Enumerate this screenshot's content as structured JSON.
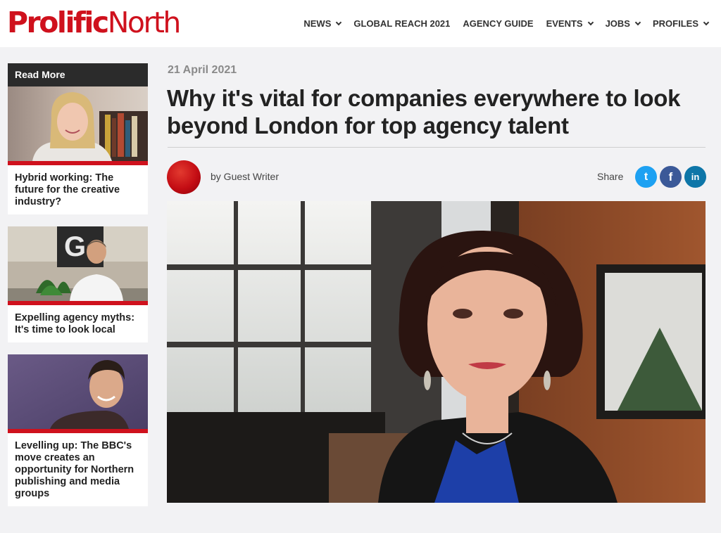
{
  "brand": {
    "part1": "Prolific",
    "part2": "North",
    "color": "#cf111d"
  },
  "nav": [
    {
      "label": "NEWS",
      "dropdown": true
    },
    {
      "label": "GLOBAL REACH 2021",
      "dropdown": false
    },
    {
      "label": "AGENCY GUIDE",
      "dropdown": false
    },
    {
      "label": "EVENTS",
      "dropdown": true
    },
    {
      "label": "JOBS",
      "dropdown": true
    },
    {
      "label": "PROFILES",
      "dropdown": true
    }
  ],
  "sidebar": {
    "heading": "Read More",
    "cards": [
      {
        "title": "Hybrid working: The future for the creative industry?"
      },
      {
        "title": "Expelling agency myths: It's time to look local"
      },
      {
        "title": "Levelling up: The BBC's move creates an opportunity for Northern publishing and media groups"
      }
    ]
  },
  "article": {
    "date": "21 April 2021",
    "headline": "Why it's vital for companies everywhere to look beyond London for top agency talent",
    "byline": "by Guest Writer",
    "share_label": "Share",
    "share": {
      "twitter": "t",
      "facebook": "f",
      "linkedin": "in"
    }
  }
}
